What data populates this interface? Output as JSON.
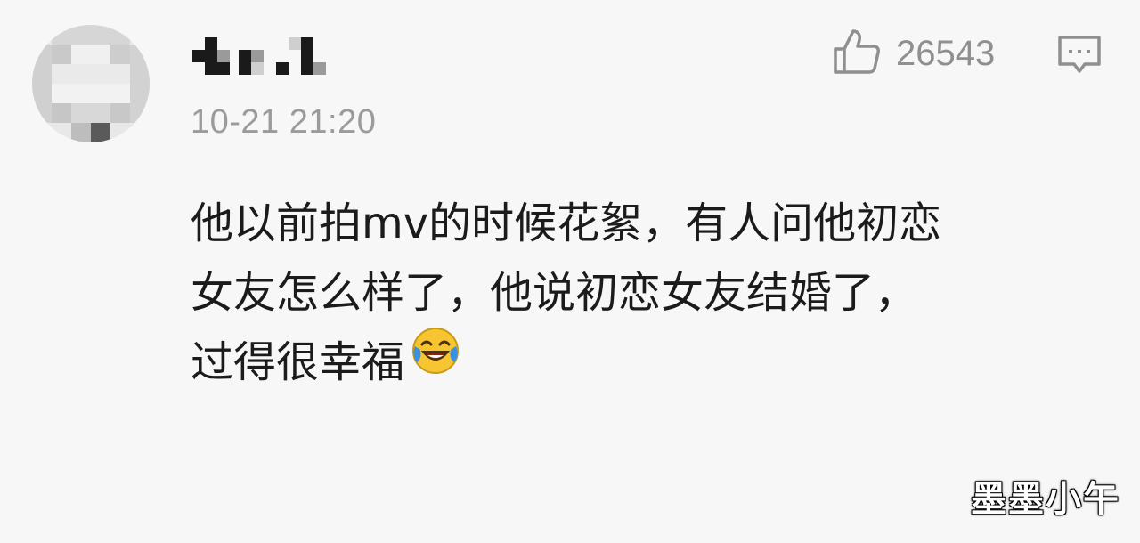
{
  "comment": {
    "timestamp": "10-21 21:20",
    "like_count": "26543",
    "text_lines": [
      "他以前拍mv的时候花絮，有人问他初恋",
      "女友怎么样了，他说初恋女友结婚了，",
      "过得很幸福"
    ],
    "emoji": "laughing-crying-emoji"
  },
  "icons": {
    "like": "thumbs-up-icon",
    "reply": "comment-bubble-icon"
  },
  "watermark": "墨墨小午",
  "colors": {
    "background": "#f7f7f7",
    "text": "#1b1b1b",
    "muted": "#9b9b9b",
    "emoji_yellow": "#f7c531",
    "emoji_blue": "#3d8fe0"
  }
}
